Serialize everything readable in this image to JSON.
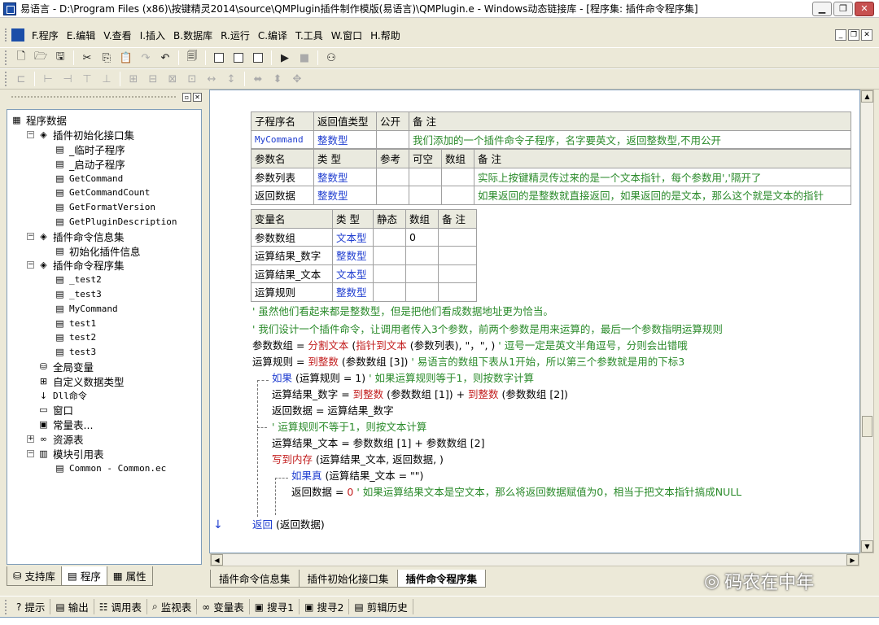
{
  "window": {
    "title": "易语言 - D:\\Program Files (x86)\\按键精灵2014\\source\\QMPlugin插件制作模版(易语言)\\QMPlugin.e - Windows动态链接库 - [程序集: 插件命令程序集]",
    "min": "▁",
    "max": "❐",
    "close": "✕"
  },
  "menu": [
    "F.程序",
    "E.编辑",
    "V.查看",
    "I.插入",
    "B.数据库",
    "R.运行",
    "C.编译",
    "T.工具",
    "W.窗口",
    "H.帮助"
  ],
  "left": {
    "tree": [
      {
        "label": "程序数据",
        "level": 0,
        "icon": "▦",
        "exp": ""
      },
      {
        "label": "插件初始化接口集",
        "level": 1,
        "icon": "◈",
        "exp": "−"
      },
      {
        "label": "_临时子程序",
        "level": 2,
        "icon": "▤",
        "exp": ""
      },
      {
        "label": "_启动子程序",
        "level": 2,
        "icon": "▤",
        "exp": ""
      },
      {
        "label": "GetCommand",
        "level": 2,
        "icon": "▤",
        "exp": "",
        "mono": true
      },
      {
        "label": "GetCommandCount",
        "level": 2,
        "icon": "▤",
        "exp": "",
        "mono": true
      },
      {
        "label": "GetFormatVersion",
        "level": 2,
        "icon": "▤",
        "exp": "",
        "mono": true
      },
      {
        "label": "GetPluginDescription",
        "level": 2,
        "icon": "▤",
        "exp": "",
        "mono": true
      },
      {
        "label": "插件命令信息集",
        "level": 1,
        "icon": "◈",
        "exp": "−"
      },
      {
        "label": "初始化插件信息",
        "level": 2,
        "icon": "▤",
        "exp": ""
      },
      {
        "label": "插件命令程序集",
        "level": 1,
        "icon": "◈",
        "exp": "−"
      },
      {
        "label": "_test2",
        "level": 2,
        "icon": "▤",
        "exp": "",
        "mono": true
      },
      {
        "label": "_test3",
        "level": 2,
        "icon": "▤",
        "exp": "",
        "mono": true
      },
      {
        "label": "MyCommand",
        "level": 2,
        "icon": "▤",
        "exp": "",
        "mono": true
      },
      {
        "label": "test1",
        "level": 2,
        "icon": "▤",
        "exp": "",
        "mono": true
      },
      {
        "label": "test2",
        "level": 2,
        "icon": "▤",
        "exp": "",
        "mono": true
      },
      {
        "label": "test3",
        "level": 2,
        "icon": "▤",
        "exp": "",
        "mono": true
      },
      {
        "label": "全局变量",
        "level": 1,
        "icon": "⛁",
        "exp": ""
      },
      {
        "label": "自定义数据类型",
        "level": 1,
        "icon": "⊞",
        "exp": ""
      },
      {
        "label": "Dll命令",
        "level": 1,
        "icon": "↓",
        "exp": "",
        "mono": true
      },
      {
        "label": "窗口",
        "level": 1,
        "icon": "▭",
        "exp": ""
      },
      {
        "label": "常量表...",
        "level": 1,
        "icon": "▣",
        "exp": ""
      },
      {
        "label": "资源表",
        "level": 1,
        "icon": "∞",
        "exp": "+"
      },
      {
        "label": "模块引用表",
        "level": 1,
        "icon": "▥",
        "exp": "−"
      },
      {
        "label": "Common - Common.ec",
        "level": 2,
        "icon": "▤",
        "exp": "",
        "mono": true
      }
    ],
    "tabs": [
      "支持库",
      "程序",
      "属性"
    ]
  },
  "sub_table": {
    "headers": [
      "子程序名",
      "返回值类型",
      "公开",
      "备 注"
    ],
    "row": [
      "MyCommand",
      "整数型",
      "",
      "我们添加的一个插件命令子程序，名字要英文，返回整数型,不用公开"
    ]
  },
  "param_table": {
    "headers": [
      "参数名",
      "类 型",
      "参考",
      "可空",
      "数组",
      "备 注"
    ],
    "rows": [
      [
        "参数列表",
        "整数型",
        "",
        "",
        "",
        "实际上按键精灵传过来的是一个文本指针，每个参数用','隔开了"
      ],
      [
        "返回数据",
        "整数型",
        "",
        "",
        "",
        "如果返回的是整数就直接返回，如果返回的是文本，那么这个就是文本的指针"
      ]
    ]
  },
  "var_table": {
    "headers": [
      "变量名",
      "类 型",
      "静态",
      "数组",
      "备 注"
    ],
    "rows": [
      [
        "参数数组",
        "文本型",
        "",
        "0",
        ""
      ],
      [
        "运算结果_数字",
        "整数型",
        "",
        "",
        ""
      ],
      [
        "运算结果_文本",
        "文本型",
        "",
        "",
        ""
      ],
      [
        "运算规则",
        "整数型",
        "",
        "",
        ""
      ]
    ]
  },
  "code": {
    "c1": "' 虽然他们看起来都是整数型，但是把他们看成数据地址更为恰当。",
    "c2": "' 我们设计一个插件命令，让调用者传入3个参数，前两个参数是用来运算的，最后一个参数指明运算规则",
    "l3a": "参数数组 = ",
    "l3b": "分割文本",
    "l3c": " (",
    "l3d": "指针到文本",
    "l3e": " (参数列表), \"，\", ) ",
    "l3f": "' 逗号一定是英文半角逗号，分则会出错哦",
    "l4a": "运算规则 = ",
    "l4b": "到整数",
    "l4c": " (参数数组 [3]) ",
    "l4d": "' 易语言的数组下表从1开始，所以第三个参数就是用的下标3",
    "l5a": "如果",
    "l5b": " (运算规则 = 1) ",
    "l5c": "' 如果运算规则等于1，则按数字计算",
    "l6a": "运算结果_数字 = ",
    "l6b": "到整数",
    "l6c": " (参数数组 [1]) + ",
    "l6d": "到整数",
    "l6e": " (参数数组 [2])",
    "l7": "返回数据 = 运算结果_数字",
    "l8": "' 运算规则不等于1，则按文本计算",
    "l9": "运算结果_文本 = 参数数组 [1] + 参数数组 [2]",
    "l10a": "写到内存",
    "l10b": " (运算结果_文本, 返回数据, )",
    "l11a": "如果真",
    "l11b": " (运算结果_文本 = \"\")",
    "l12a": "返回数据 = ",
    "l12b": "0",
    "l12c": " ' 如果运算结果文本是空文本，那么将返回数据赋值为0，相当于把文本指针搞成NULL",
    "l13a": "返回",
    "l13b": " (返回数据)"
  },
  "editor_tabs": [
    "插件命令信息集",
    "插件初始化接口集",
    "插件命令程序集"
  ],
  "watermark": "码农在中年",
  "output_tabs": [
    "提示",
    "输出",
    "调用表",
    "监视表",
    "变量表",
    "搜寻1",
    "搜寻2",
    "剪辑历史"
  ]
}
